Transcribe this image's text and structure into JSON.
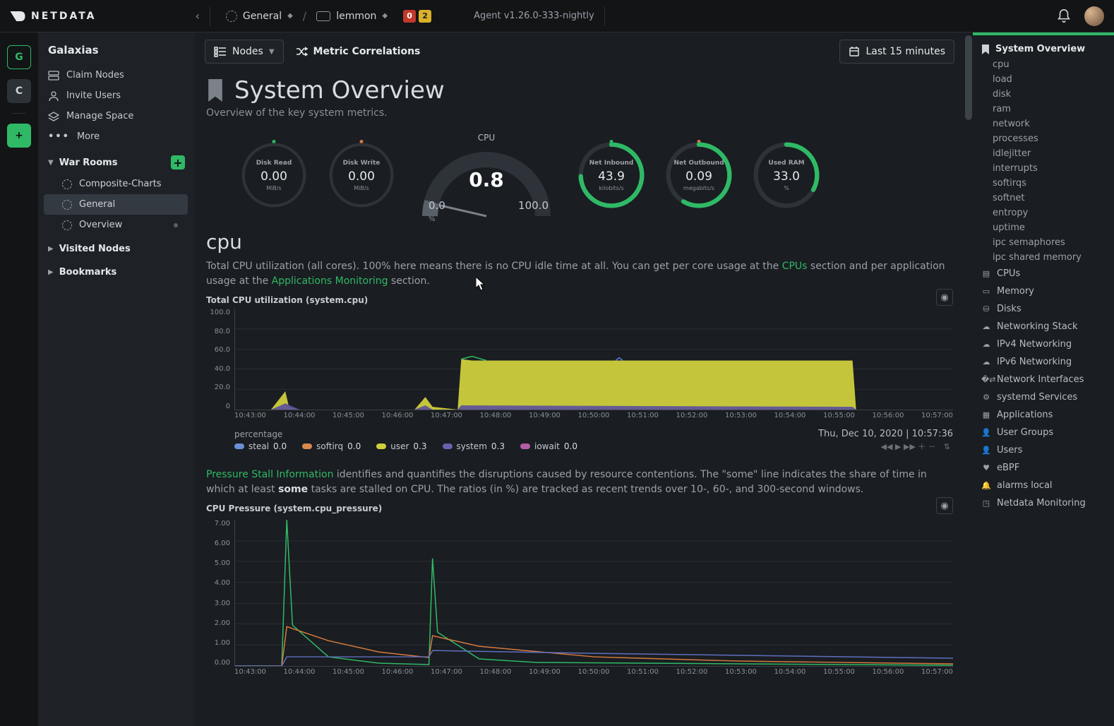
{
  "brand": "NETDATA",
  "top": {
    "space": "General",
    "host": "lemmon",
    "alarm_crit": "0",
    "alarm_warn": "2",
    "agent": "Agent v1.26.0-333-nightly"
  },
  "rail": {
    "g": "G",
    "c": "C",
    "add": "+"
  },
  "sidebar": {
    "title": "Galaxias",
    "claim": "Claim Nodes",
    "invite": "Invite Users",
    "manage": "Manage Space",
    "more": "More",
    "war_rooms": "War Rooms",
    "rooms": [
      "Composite-Charts",
      "General",
      "Overview"
    ],
    "visited": "Visited Nodes",
    "bookmarks": "Bookmarks"
  },
  "toolbar": {
    "nodes": "Nodes",
    "metric": "Metric Correlations",
    "range": "Last 15 minutes"
  },
  "page": {
    "title": "System Overview",
    "sub": "Overview of the key system metrics."
  },
  "gauges": {
    "disk_read": {
      "title": "Disk Read",
      "val": "0.00",
      "unit": "MiB/s"
    },
    "disk_write": {
      "title": "Disk Write",
      "val": "0.00",
      "unit": "MiB/s"
    },
    "cpu": {
      "title": "CPU",
      "val": "0.8",
      "min": "0.0",
      "max": "100.0",
      "pct": "%"
    },
    "net_in": {
      "title": "Net Inbound",
      "val": "43.9",
      "unit": "kilobits/s"
    },
    "net_out": {
      "title": "Net Outbound",
      "val": "0.09",
      "unit": "megabits/s"
    },
    "ram": {
      "title": "Used RAM",
      "val": "33.0",
      "unit": "%"
    }
  },
  "cpu_sec": {
    "title": "cpu",
    "desc1": "Total CPU utilization (all cores). 100% here means there is no CPU idle time at all. You can get per core usage at the ",
    "link1": "CPUs",
    "desc2": " section and per application usage at the ",
    "link2": "Applications Monitoring",
    "desc3": " section.",
    "chart1_title": "Total CPU utilization (system.cpu)",
    "ylabels1": [
      "100.0",
      "80.0",
      "60.0",
      "40.0",
      "20.0",
      "0"
    ],
    "xlabels": [
      "10:43:00",
      "10:44:00",
      "10:45:00",
      "10:46:00",
      "10:47:00",
      "10:48:00",
      "10:49:00",
      "10:50:00",
      "10:51:00",
      "10:52:00",
      "10:53:00",
      "10:54:00",
      "10:55:00",
      "10:56:00",
      "10:57:00"
    ],
    "legend_l": "percentage",
    "timestamp": "Thu, Dec 10, 2020 | 10:57:36",
    "legends": [
      {
        "c": "#6b8fd6",
        "n": "steal",
        "v": "0.0"
      },
      {
        "c": "#d68a4e",
        "n": "softirq",
        "v": "0.0"
      },
      {
        "c": "#cfcf3d",
        "n": "user",
        "v": "0.3"
      },
      {
        "c": "#6b5fb0",
        "n": "system",
        "v": "0.3"
      },
      {
        "c": "#b25da8",
        "n": "iowait",
        "v": "0.0"
      }
    ],
    "psi1": "Pressure Stall Information",
    "psi2": " identifies and quantifies the disruptions caused by resource contentions. The \"some\" line indicates the share of time in which at least ",
    "psi_b": "some",
    "psi3": " tasks are stalled on CPU. The ratios (in %) are tracked as recent trends over 10-, 60-, and 300-second windows.",
    "chart2_title": "CPU Pressure (system.cpu_pressure)",
    "ylabels2": [
      "7.00",
      "6.00",
      "5.00",
      "4.00",
      "3.00",
      "2.00",
      "1.00",
      "0.00"
    ]
  },
  "rside": {
    "overview": "System Overview",
    "subs": [
      "cpu",
      "load",
      "disk",
      "ram",
      "network",
      "processes",
      "idlejitter",
      "interrupts",
      "softirqs",
      "softnet",
      "entropy",
      "uptime",
      "ipc semaphores",
      "ipc shared memory"
    ],
    "cats": [
      {
        "i": "cpu",
        "l": "CPUs"
      },
      {
        "i": "mem",
        "l": "Memory"
      },
      {
        "i": "disk",
        "l": "Disks"
      },
      {
        "i": "cloud",
        "l": "Networking Stack"
      },
      {
        "i": "cloud",
        "l": "IPv4 Networking"
      },
      {
        "i": "cloud",
        "l": "IPv6 Networking"
      },
      {
        "i": "net",
        "l": "Network Interfaces"
      },
      {
        "i": "gear",
        "l": "systemd Services"
      },
      {
        "i": "app",
        "l": "Applications"
      },
      {
        "i": "user",
        "l": "User Groups"
      },
      {
        "i": "user",
        "l": "Users"
      },
      {
        "i": "heart",
        "l": "eBPF"
      },
      {
        "i": "bell",
        "l": "alarms local"
      },
      {
        "i": "nd",
        "l": "Netdata Monitoring"
      }
    ]
  },
  "chart_data": [
    {
      "type": "area",
      "title": "Total CPU utilization (system.cpu)",
      "ylabel": "percentage",
      "ylim": [
        0,
        100
      ],
      "x": [
        "10:43",
        "10:44",
        "10:45",
        "10:46",
        "10:47",
        "10:47:30",
        "10:48",
        "10:49",
        "10:50",
        "10:51",
        "10:52",
        "10:53",
        "10:54",
        "10:55",
        "10:55:30",
        "10:56",
        "10:57"
      ],
      "series": [
        {
          "name": "user",
          "color": "#cfcf3d",
          "values": [
            1,
            18,
            2,
            2,
            12,
            2,
            48,
            48,
            48,
            48,
            48,
            48,
            48,
            48,
            48,
            1,
            1
          ]
        },
        {
          "name": "system",
          "color": "#6b5fb0",
          "values": [
            1,
            6,
            1,
            1,
            4,
            1,
            3,
            2,
            2,
            2,
            2,
            2,
            2,
            2,
            2,
            1,
            1
          ]
        },
        {
          "name": "softirq",
          "color": "#d68a4e",
          "values": [
            0,
            2,
            0,
            0,
            1,
            0,
            1,
            0,
            0,
            0,
            0,
            0,
            0,
            0,
            0,
            0,
            0
          ]
        },
        {
          "name": "steal",
          "color": "#6b8fd6",
          "values": [
            0,
            0,
            0,
            0,
            0,
            0,
            0,
            0,
            0,
            0,
            0,
            0,
            0,
            0,
            0,
            0,
            0
          ]
        },
        {
          "name": "iowait",
          "color": "#b25da8",
          "values": [
            0,
            0,
            0,
            0,
            0,
            0,
            0,
            0,
            0,
            0,
            0,
            0,
            0,
            0,
            0,
            0,
            0
          ]
        }
      ]
    },
    {
      "type": "line",
      "title": "CPU Pressure (system.cpu_pressure)",
      "ylim": [
        0,
        7.5
      ],
      "x": [
        "10:43",
        "10:44",
        "10:44:10",
        "10:45",
        "10:46",
        "10:47",
        "10:47:10",
        "10:48",
        "10:49",
        "10:50",
        "10:51",
        "10:52",
        "10:53",
        "10:54",
        "10:55",
        "10:56",
        "10:57"
      ],
      "series": [
        {
          "name": "some10",
          "color": "#2fb966",
          "values": [
            0,
            0,
            7.5,
            0.3,
            0.1,
            0,
            5.4,
            0.4,
            0.1,
            0,
            0,
            0,
            0,
            0,
            0,
            0,
            0
          ]
        },
        {
          "name": "some60",
          "color": "#d67a3e",
          "values": [
            0,
            0,
            2.0,
            1.3,
            0.7,
            0.4,
            1.6,
            1.0,
            0.6,
            0.4,
            0.3,
            0.2,
            0.15,
            0.1,
            0.08,
            0.05,
            0.04
          ]
        },
        {
          "name": "some300",
          "color": "#5f6fc0",
          "values": [
            0,
            0,
            0.5,
            0.5,
            0.5,
            0.45,
            0.8,
            0.8,
            0.75,
            0.7,
            0.65,
            0.6,
            0.55,
            0.5,
            0.45,
            0.4,
            0.38
          ]
        }
      ]
    }
  ]
}
